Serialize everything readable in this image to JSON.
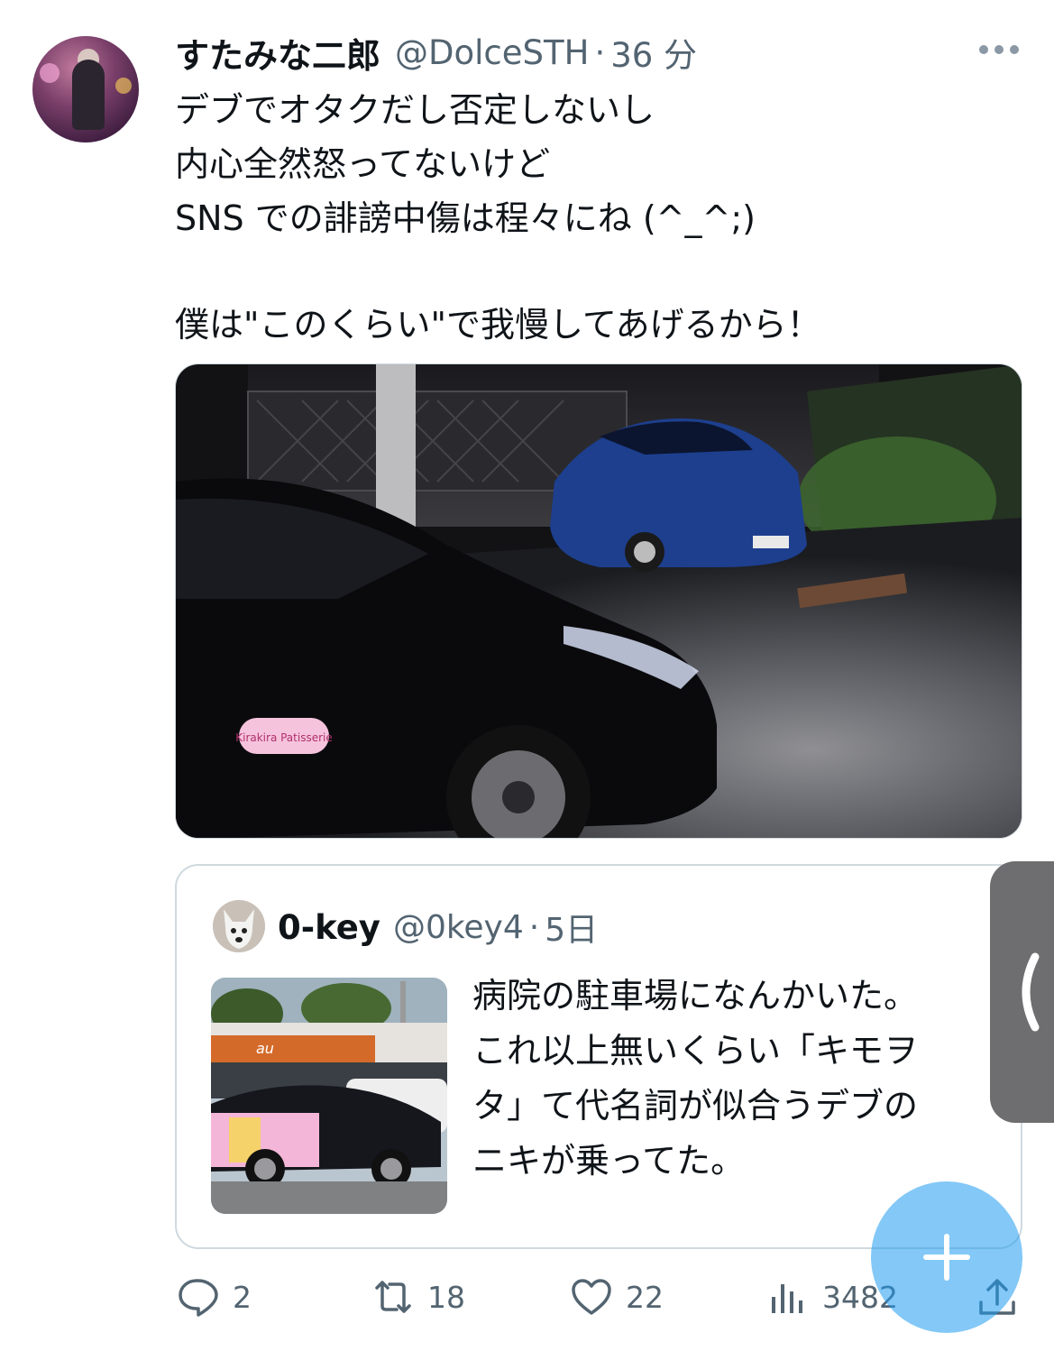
{
  "tweet": {
    "author_name": "すたみな二郎",
    "handle": "@DolceSTH",
    "separator": "·",
    "time": "36 分",
    "lines": [
      "デブでオタクだし否定しないし",
      "内心全然怒ってないけど",
      "SNS での誹謗中傷は程々にね (^_^;)",
      "",
      "僕は\"このくらい\"で我慢してあげるから！"
    ],
    "media_label": "Kirakira Patisserie"
  },
  "quote": {
    "author_name": "0-key",
    "handle": "@0key4",
    "separator": "·",
    "time": "5日",
    "lines": [
      "病院の駐車場になんかいた。",
      "これ以上無いくらい「キモヲ",
      "タ」て代名詞が似合うデブの",
      "ニキが乗ってた。"
    ],
    "thumb_sign": "au"
  },
  "actions": {
    "reply_count": "2",
    "retweet_count": "18",
    "like_count": "22",
    "views_count": "3482"
  },
  "icons": [
    "more-icon",
    "reply-icon",
    "retweet-icon",
    "like-icon",
    "views-icon",
    "share-icon",
    "chevron-left-icon",
    "plus-icon"
  ],
  "colors": {
    "text": "#0f1419",
    "secondary": "#536471",
    "accent": "#1d9bf0",
    "border": "#cfd9de"
  }
}
